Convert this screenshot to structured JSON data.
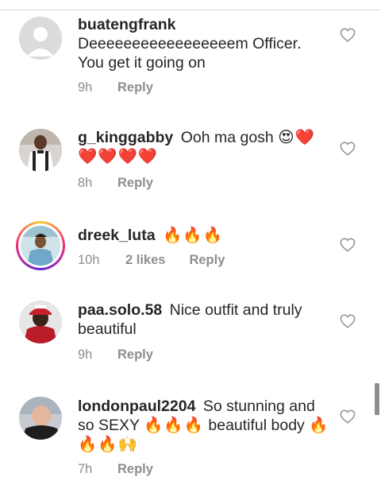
{
  "comments": [
    {
      "username": "buatengfrank",
      "text": "Deeeeeeeeeeeeeeeeem Officer. You get it going on",
      "emoji": "",
      "time": "9h",
      "likes": "",
      "reply_label": "Reply"
    },
    {
      "username": "g_kinggabby",
      "text": "Ooh ma gosh",
      "emoji": "😍❤️❤️❤️❤️❤️",
      "time": "8h",
      "likes": "",
      "reply_label": "Reply"
    },
    {
      "username": "dreek_luta",
      "text": "",
      "emoji": "🔥🔥🔥",
      "time": "10h",
      "likes": "2 likes",
      "reply_label": "Reply"
    },
    {
      "username": "paa.solo.58",
      "text": "Nice outfit and truly beautiful",
      "emoji": "",
      "time": "9h",
      "likes": "",
      "reply_label": "Reply"
    },
    {
      "username": "londonpaul2204",
      "text": "So stunning and so SEXY",
      "emoji": "🔥🔥🔥",
      "text2": "beautiful body",
      "emoji2": "🔥🔥🔥🙌",
      "time": "7h",
      "likes": "",
      "reply_label": "Reply"
    }
  ],
  "colors": {
    "text": "#262626",
    "meta": "#8e8e8e",
    "divider": "#dbdbdb"
  },
  "icons": {
    "like": "heart-outline-icon"
  }
}
